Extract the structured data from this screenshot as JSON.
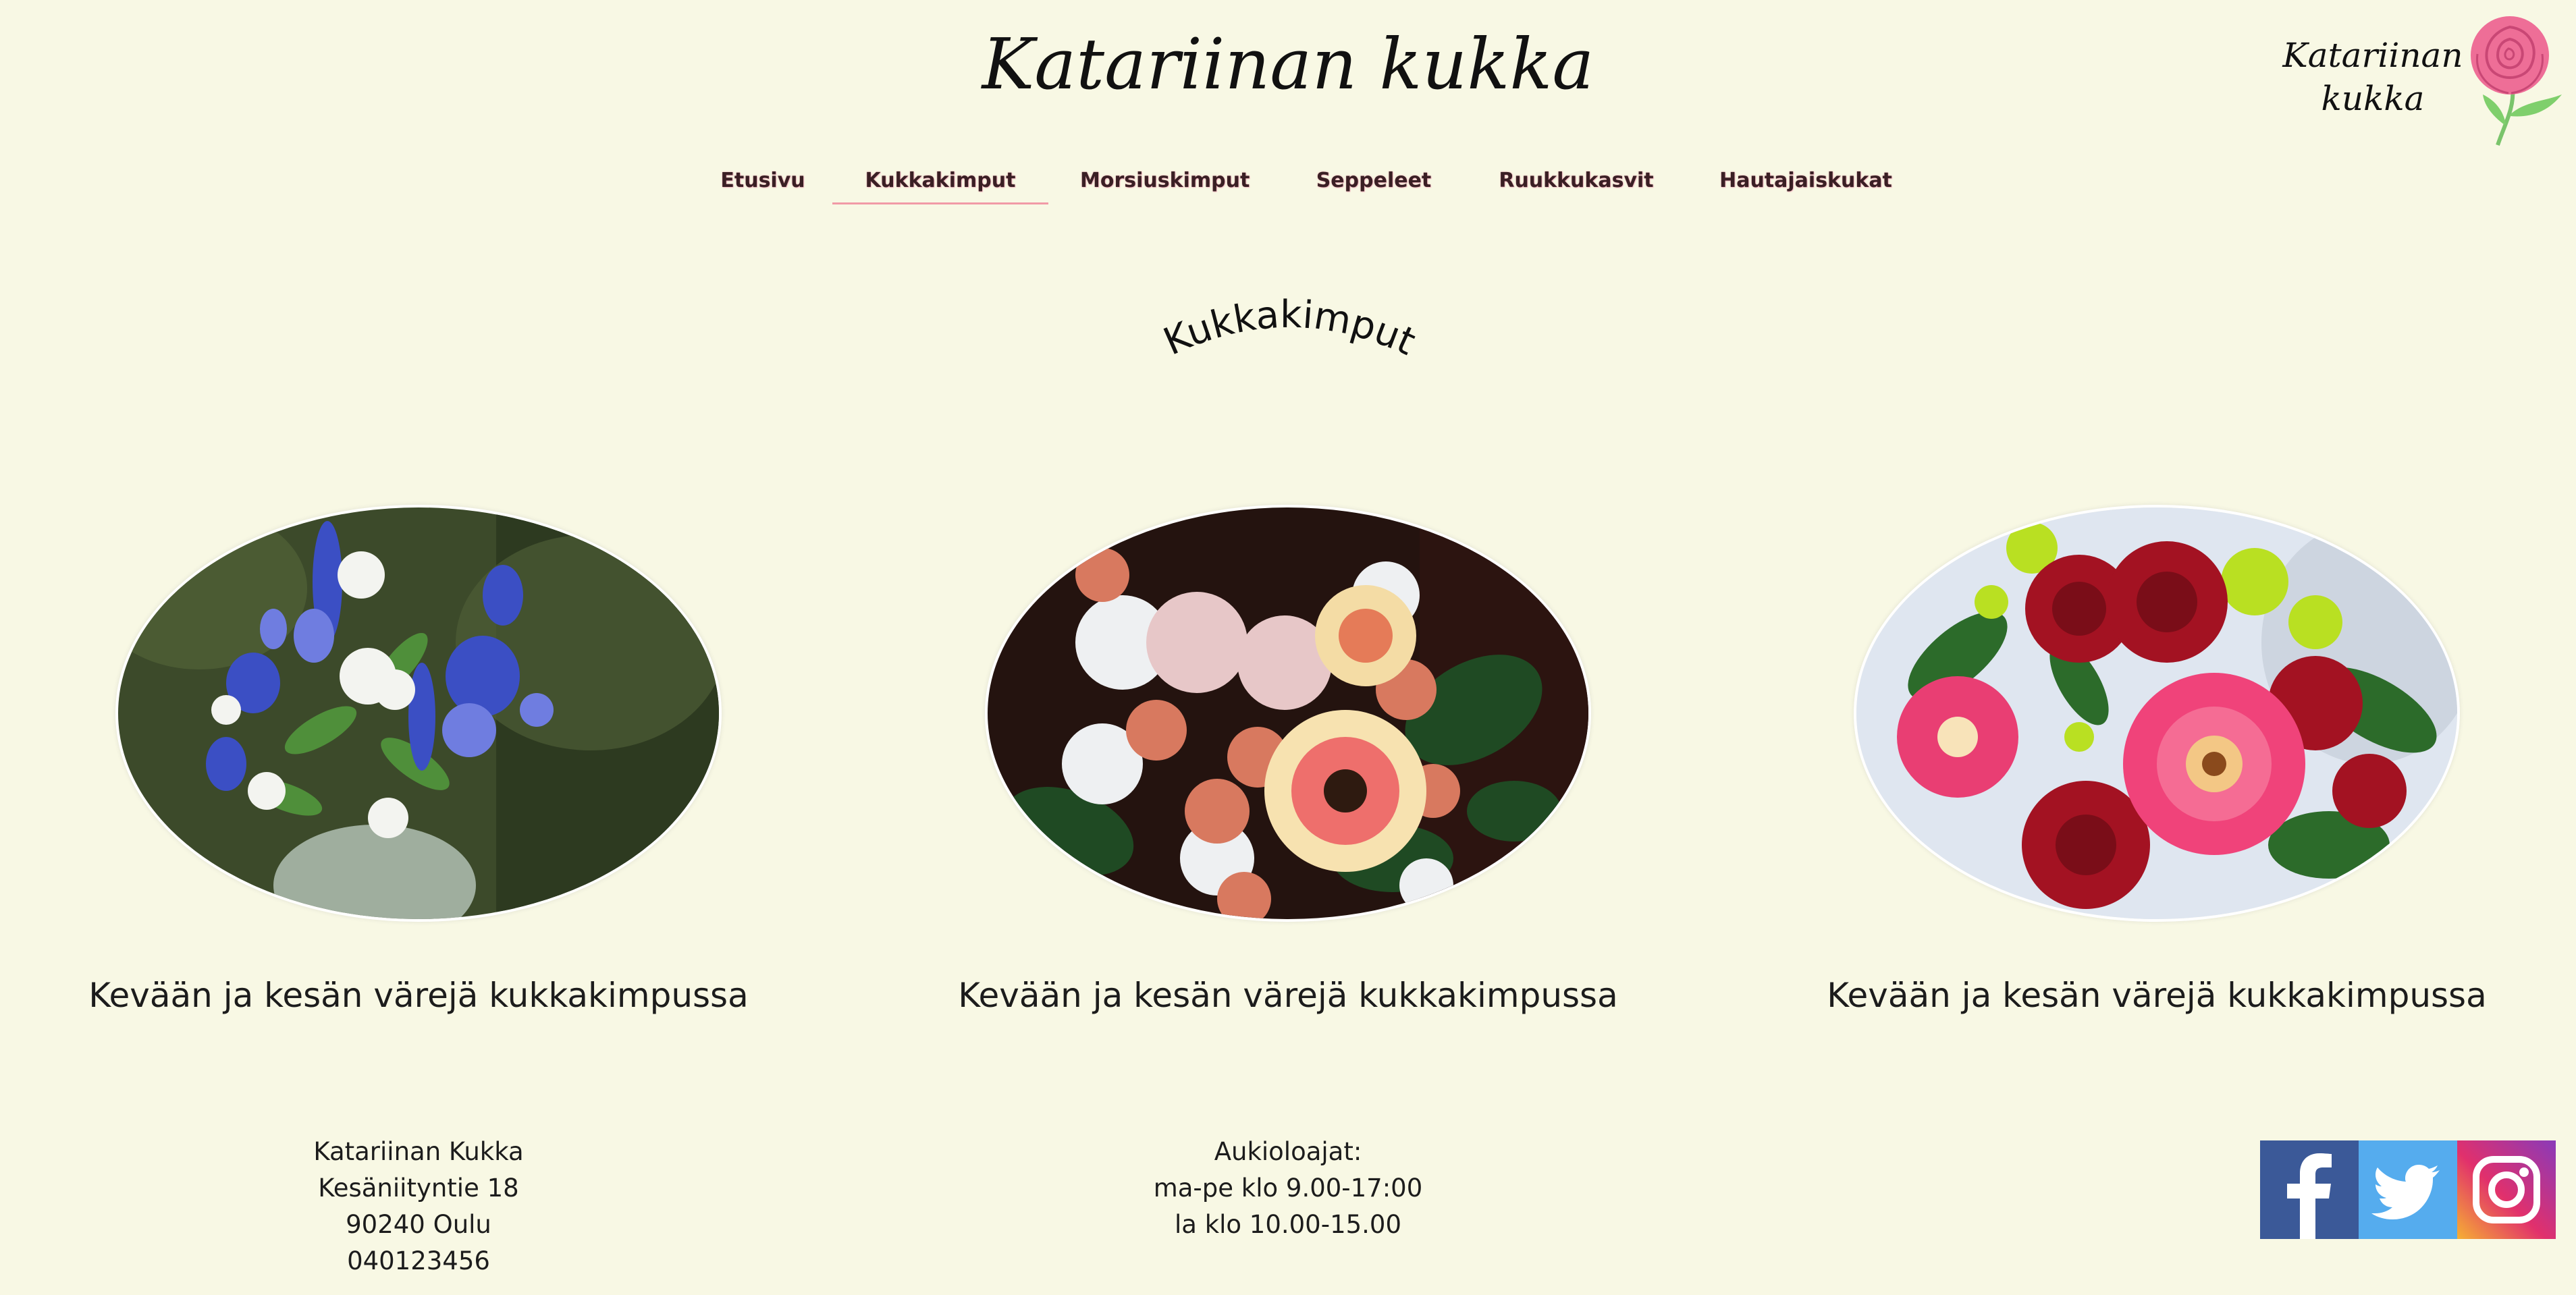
{
  "header": {
    "site_title": "Katariinan kukka",
    "logo_line1": "Katariinan",
    "logo_line2": "kukka"
  },
  "nav": {
    "items": [
      {
        "label": "Etusivu",
        "active": false
      },
      {
        "label": "Kukkakimput",
        "active": true
      },
      {
        "label": "Morsiuskimput",
        "active": false
      },
      {
        "label": "Seppeleet",
        "active": false
      },
      {
        "label": "Ruukkukasvit",
        "active": false
      },
      {
        "label": "Hautajaiskukat",
        "active": false
      }
    ]
  },
  "page": {
    "heading": "Kukkakimput"
  },
  "products": [
    {
      "caption": "Kevään ja kesän värejä kukkakimpussa",
      "image": "blue-white-bouquet"
    },
    {
      "caption": "Kevään ja kesän värejä kukkakimpussa",
      "image": "peach-gerbera-bouquet"
    },
    {
      "caption": "Kevään ja kesän värejä kukkakimpussa",
      "image": "red-pink-bouquet"
    }
  ],
  "footer": {
    "address": {
      "name": "Katariinan Kukka",
      "street": "Kesäniityntie 18",
      "city": "90240 Oulu",
      "phone": "040123456"
    },
    "hours": {
      "title": "Aukioloajat:",
      "weekdays": "ma-pe klo 9.00-17:00",
      "saturday": "la klo 10.00-15.00"
    },
    "social": [
      {
        "icon": "facebook-icon",
        "color": "#3b5998"
      },
      {
        "icon": "twitter-icon",
        "color": "#55acee"
      },
      {
        "icon": "instagram-icon",
        "color": "#c13584"
      }
    ]
  },
  "colors": {
    "background": "#f8f8e4",
    "nav_active_underline": "#f19aa6",
    "logo_rose": "#ee6e97"
  }
}
